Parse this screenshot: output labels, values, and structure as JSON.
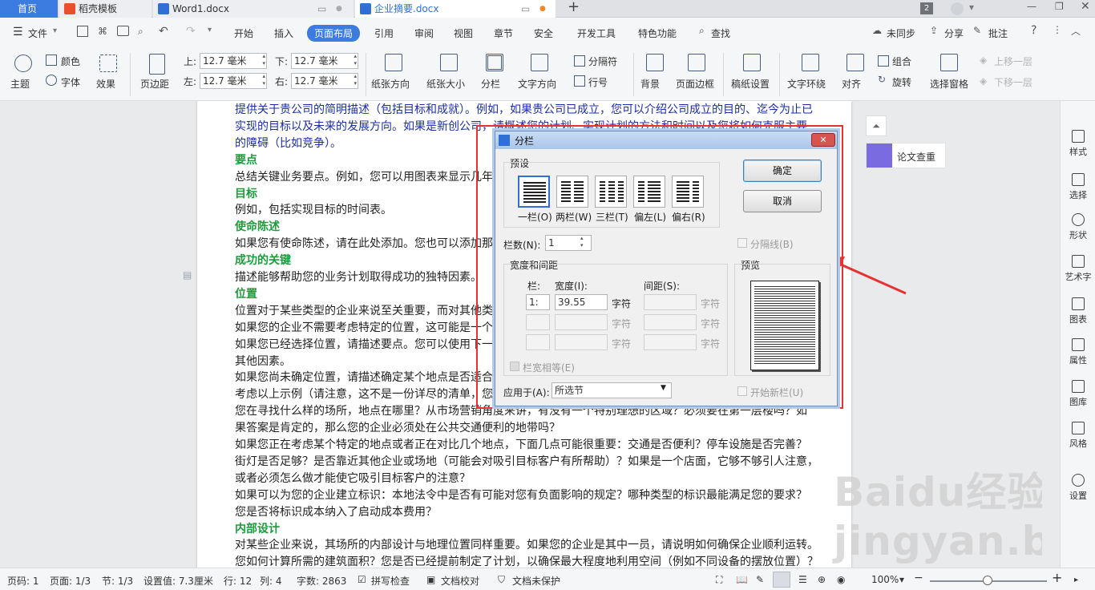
{
  "tabs": [
    {
      "label": "首页"
    },
    {
      "label": "稻壳模板"
    },
    {
      "label": "Word1.docx"
    },
    {
      "label": "企业摘要.docx"
    }
  ],
  "tab_counter": "2",
  "menu": {
    "file": "文件",
    "items": [
      "开始",
      "插入",
      "页面布局",
      "引用",
      "审阅",
      "视图",
      "章节",
      "安全",
      "开发工具",
      "特色功能",
      "查找"
    ],
    "sync": "未同步",
    "share": "分享",
    "comment": "批注"
  },
  "ribbon": {
    "theme": "主题",
    "color": "颜色",
    "font": "字体",
    "effect": "效果",
    "margins": "页边距",
    "top_label": "上:",
    "top_value": "12.7 毫米",
    "bottom_label": "下:",
    "bottom_value": "12.7 毫米",
    "left_label": "左:",
    "left_value": "12.7 毫米",
    "right_label": "右:",
    "right_value": "12.7 毫米",
    "orientation": "纸张方向",
    "size": "纸张大小",
    "columns": "分栏",
    "text_direction": "文字方向",
    "breaks": "分隔符",
    "line_numbers": "行号",
    "background": "背景",
    "page_border": "页面边框",
    "grid_paper": "稿纸设置",
    "text_wrap": "文字环绕",
    "align": "对齐",
    "group": "组合",
    "rotate": "旋转",
    "selection_pane": "选择窗格",
    "bring_forward": "上移一层",
    "send_backward": "下移一层"
  },
  "document": {
    "lines": [
      {
        "t": "提供关于贵公司的简明描述（包括目标和成就）。例如，如果贵公司已成立，您可以介绍公司成立的目的、迄今为止已",
        "s": "blue"
      },
      {
        "t": "实现的目标以及未来的发展方向。如果是新创公司，请概述您的计划、实现计划的方法和时间以及您将如何克服主要",
        "s": "blue"
      },
      {
        "t": "的障碍（比如竞争）。",
        "s": "blue"
      },
      {
        "t": "要点",
        "s": "head"
      },
      {
        "t": "总结关键业务要点。例如，您可以用图表来显示几年",
        "s": ""
      },
      {
        "t": "目标",
        "s": "head"
      },
      {
        "t": "例如，包括实现目标的时间表。",
        "s": ""
      },
      {
        "t": "使命陈述",
        "s": "head"
      },
      {
        "t": "如果您有使命陈述，请在此处添加。您也可以添加那",
        "s": ""
      },
      {
        "t": "成功的关键",
        "s": "head"
      },
      {
        "t": "描述能够帮助您的业务计划取得成功的独特因素。",
        "s": ""
      },
      {
        "t": "位置",
        "s": "head"
      },
      {
        "t": "位置对于某些类型的企业来说至关重要，而对其他类",
        "s": ""
      },
      {
        "t": "如果您的企业不需要考虑特定的位置，这可能是一个",
        "s": ""
      },
      {
        "t": "如果您已经选择位置，请描述要点。您可以使用下一",
        "s": ""
      },
      {
        "t": "其他因素。",
        "s": ""
      },
      {
        "t": "如果您尚未确定位置，请描述确定某个地点是否适合",
        "s": ""
      },
      {
        "t": "考虑以上示例（请注意，这不是一份详尽的清单，您",
        "s": ""
      },
      {
        "t": "您在寻找什么样的场所，地点在哪里？从市场营销角度来讲，有没有一个特别理想的区域？必须要在第一层楼吗？如",
        "s": ""
      },
      {
        "t": "果答案是肯定的，那么您的企业必须处在公共交通便利的地带吗？",
        "s": ""
      },
      {
        "t": "如果您正在考虑某个特定的地点或者正在对比几个地点，下面几点可能很重要：交通是否便利？停车设施是否完善？",
        "s": ""
      },
      {
        "t": "街灯是否足够？是否靠近其他企业或场地（可能会对吸引目标客户有所帮助）？如果是一个店面，它够不够引人注意，",
        "s": ""
      },
      {
        "t": "或者必须怎么做才能使它吸引目标客户的注意？",
        "s": ""
      },
      {
        "t": "如果可以为您的企业建立标识：本地法令中是否有可能对您有负面影响的规定？哪种类型的标识最能满足您的要求？",
        "s": ""
      },
      {
        "t": "您是否将标识成本纳入了启动成本费用？",
        "s": ""
      },
      {
        "t": "内部设计",
        "s": "head"
      },
      {
        "t": "对某些企业来说，其场所的内部设计与地理位置同样重要。如果您的企业是其中一员，请说明如何确保企业顺利运转。",
        "s": ""
      },
      {
        "t": "您如何计算所需的建筑面积？您是否已经提前制定了计划，以确保最大程度地利用空间（例如不同设备的摆放位置）？",
        "s": ""
      }
    ]
  },
  "side_panel": {
    "check_label": "论文查重",
    "items": [
      "样式",
      "选择",
      "形状",
      "艺术字",
      "图表",
      "属性",
      "图库",
      "风格",
      "设置"
    ]
  },
  "status": {
    "page_num": "页码: 1",
    "pages": "页面: 1/3",
    "section": "节: 1/3",
    "setting": "设置值: 7.3厘米",
    "row": "行: 12",
    "col": "列: 4",
    "word_count": "字数: 2863",
    "spell": "拼写检查",
    "proof": "文档校对",
    "protect": "文档未保护",
    "zoom": "100%"
  },
  "dialog": {
    "title": "分栏",
    "preset_label": "预设",
    "presets": [
      "一栏(O)",
      "两栏(W)",
      "三栏(T)",
      "偏左(L)",
      "偏右(R)"
    ],
    "num_cols_label": "栏数(N):",
    "num_cols_value": "1",
    "separator_label": "分隔线(B)",
    "width_spacing_label": "宽度和间距",
    "col_header": "栏:",
    "width_header": "宽度(I):",
    "spacing_header": "间距(S):",
    "row1_col": "1:",
    "row1_width": "39.55",
    "unit": "字符",
    "equal_width_label": "栏宽相等(E)",
    "preview_label": "预览",
    "apply_label": "应用于(A):",
    "apply_value": "所选节",
    "new_col_label": "开始新栏(U)",
    "ok": "确定",
    "cancel": "取消"
  },
  "watermark": "Baidu经验 jingyan.baidu.com",
  "colors": {
    "accent": "#3c7be0",
    "heading": "#1c9c3c",
    "body_blue": "#1b2ea6",
    "highlight": "#e63232"
  }
}
